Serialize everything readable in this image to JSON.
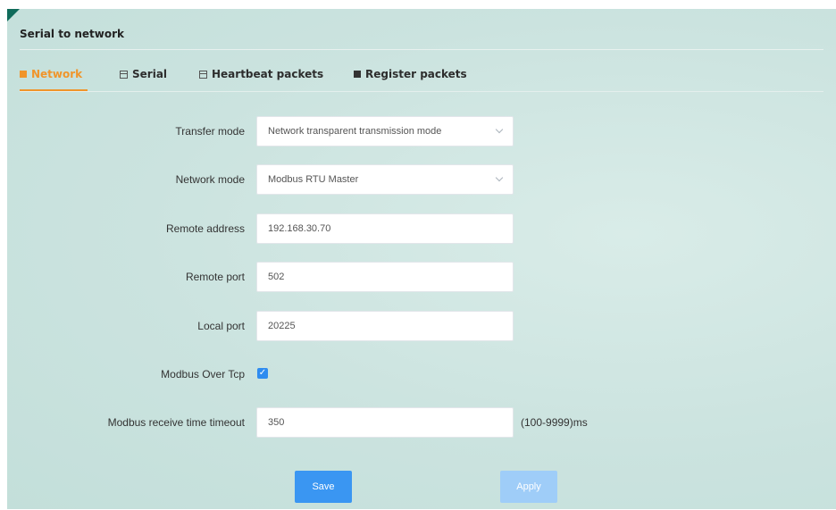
{
  "panel": {
    "title": "Serial to network"
  },
  "tabs": [
    {
      "label": "Network",
      "icon": "network-icon",
      "active": true,
      "color": "#f0952b"
    },
    {
      "label": "Serial",
      "icon": "calendar-icon"
    },
    {
      "label": "Heartbeat packets",
      "icon": "calendar-icon"
    },
    {
      "label": "Register packets",
      "icon": "square-icon"
    }
  ],
  "form": {
    "transfer_mode": {
      "label": "Transfer mode",
      "value": "Network transparent transmission mode"
    },
    "network_mode": {
      "label": "Network mode",
      "value": "Modbus RTU Master"
    },
    "remote_address": {
      "label": "Remote address",
      "value": "192.168.30.70"
    },
    "remote_port": {
      "label": "Remote port",
      "value": "502"
    },
    "local_port": {
      "label": "Local port",
      "value": "20225"
    },
    "modbus_over_tcp": {
      "label": "Modbus Over Tcp",
      "checked": true
    },
    "modbus_timeout": {
      "label": "Modbus receive time timeout",
      "value": "350",
      "suffix": "(100-9999)ms"
    }
  },
  "actions": {
    "save_label": "Save",
    "apply_label": "Apply"
  },
  "colors": {
    "accent": "#f0952b",
    "primary": "#3a96f2",
    "primary_disabled": "#9fcdf8",
    "header_corner": "#0f6b5a"
  }
}
